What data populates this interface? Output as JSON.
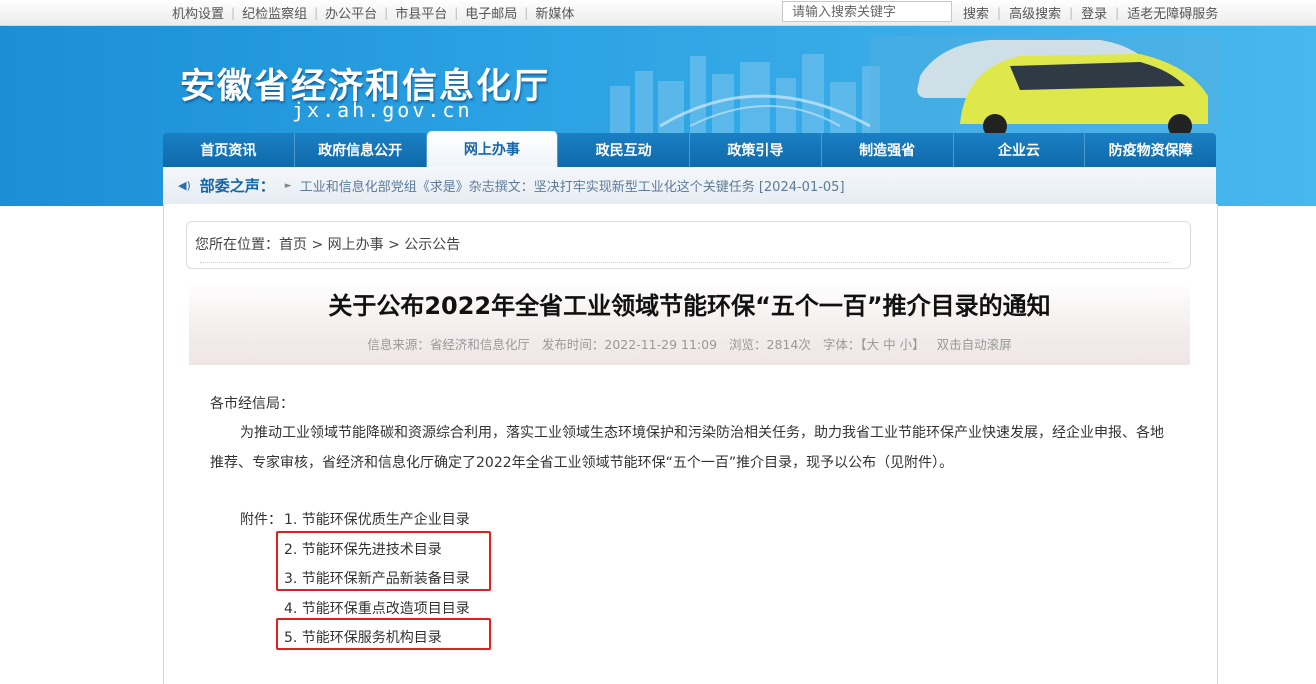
{
  "topbar": {
    "links": [
      "机构设置",
      "纪检监察组",
      "办公平台",
      "市县平台",
      "电子邮局",
      "新媒体"
    ],
    "search_placeholder": "请输入搜索关键字",
    "right_links": [
      "搜索",
      "高级搜索",
      "登录",
      "适老无障碍服务"
    ]
  },
  "header": {
    "site_name": "安徽省经济和信息化厅",
    "domain": "jx.ah.gov.cn"
  },
  "nav": {
    "items": [
      "首页资讯",
      "政府信息公开",
      "网上办事",
      "政民互动",
      "政策引导",
      "制造强省",
      "企业云",
      "防疫物资保障"
    ],
    "active_index": 2
  },
  "notice": {
    "label": "部委之声：",
    "text": "工业和信息化部党组《求是》杂志撰文：坚决打牢实现新型工业化这个关键任务 [2024-01-05]"
  },
  "breadcrumb": {
    "prefix": "您所在位置：",
    "items": [
      "首页",
      "网上办事",
      "公示公告"
    ],
    "separator": ">"
  },
  "article": {
    "title": "关于公布2022年全省工业领域节能环保“五个一百”推介目录的通知",
    "meta": {
      "source": "信息来源：省经济和信息化厅",
      "time": "发布时间：2022-11-29 11:09",
      "views": "浏览：2814次",
      "font_label": "字体：【",
      "font_large": "大",
      "font_medium": "中",
      "font_small": "小",
      "font_close": "】",
      "autoscroll": "双击自动滚屏"
    },
    "salutation": "各市经信局：",
    "paragraph": "为推动工业领域节能降碳和资源综合利用，落实工业领域生态环境保护和污染防治相关任务，助力我省工业节能环保产业快速发展，经企业申报、各地推荐、专家审核，省经济和信息化厅确定了2022年全省工业领域节能环保“五个一百”推介目录，现予以公布（见附件）。",
    "attachment_label": "附件：",
    "attachments": [
      "1. 节能环保优质生产企业目录",
      "2. 节能环保先进技术目录",
      "3. 节能环保新产品新装备目录",
      "4. 节能环保重点改造项目目录",
      "5. 节能环保服务机构目录"
    ]
  },
  "colors": {
    "banner_blue": "#2ba2e3",
    "nav_blue": "#0f6aaa",
    "highlight_red": "#e0201a"
  }
}
